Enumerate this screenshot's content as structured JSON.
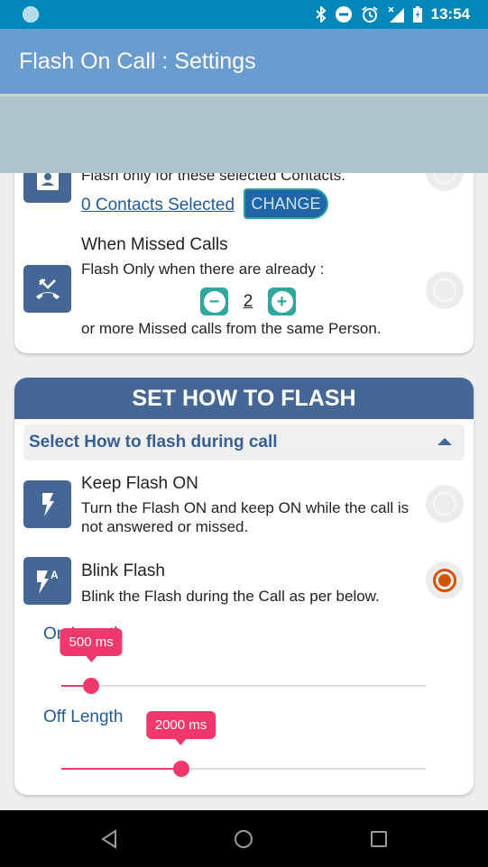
{
  "status_bar": {
    "time": "13:54",
    "icons": [
      "notification-dot-icon",
      "bluetooth-icon",
      "do-not-disturb-icon",
      "alarm-icon",
      "no-signal-icon",
      "battery-charging-icon"
    ]
  },
  "app_bar": {
    "title": "Flash On Call : Settings"
  },
  "contacts_row": {
    "icon": "contact-icon",
    "text": "Flash only for these selected Contacts.",
    "link": "0 Contacts Selected",
    "change_label": "CHANGE",
    "selected": false
  },
  "missed_calls_row": {
    "icon": "missed-call-icon",
    "title": "When Missed Calls",
    "text_before": "Flash Only when there are already :",
    "count": "2",
    "decrement_icon": "minus-icon",
    "increment_icon": "plus-icon",
    "text_after": "or more Missed calls from the same Person.",
    "selected": false
  },
  "flash_section": {
    "header": "SET HOW TO FLASH",
    "dropdown_label": "Select How to flash during call",
    "dropdown_expanded": true,
    "options": [
      {
        "icon": "flash-icon",
        "title": "Keep Flash ON",
        "text": "Turn the Flash ON and keep ON while the call is not answered or missed.",
        "selected": false
      },
      {
        "icon": "flash-auto-icon",
        "title": "Blink Flash",
        "text": "Blink the Flash during the Call as per below.",
        "selected": true
      }
    ],
    "sliders": [
      {
        "label": "On Length",
        "value_label": "500 ms",
        "value_ms": 500,
        "max_ms": 5000
      },
      {
        "label": "Off Length",
        "value_label": "2000 ms",
        "value_ms": 2000,
        "max_ms": 5000
      }
    ]
  },
  "colors": {
    "status_bar": "#0288b8",
    "app_bar": "#6b9ccf",
    "banner": "#adc4cb",
    "accent_blue": "#456796",
    "teal": "#2ea89f",
    "slider_pink": "#f0386b",
    "radio_checked": "#d35400"
  },
  "nav_bar": {
    "back_icon": "back-icon",
    "home_icon": "home-icon",
    "recents_icon": "recents-icon"
  }
}
